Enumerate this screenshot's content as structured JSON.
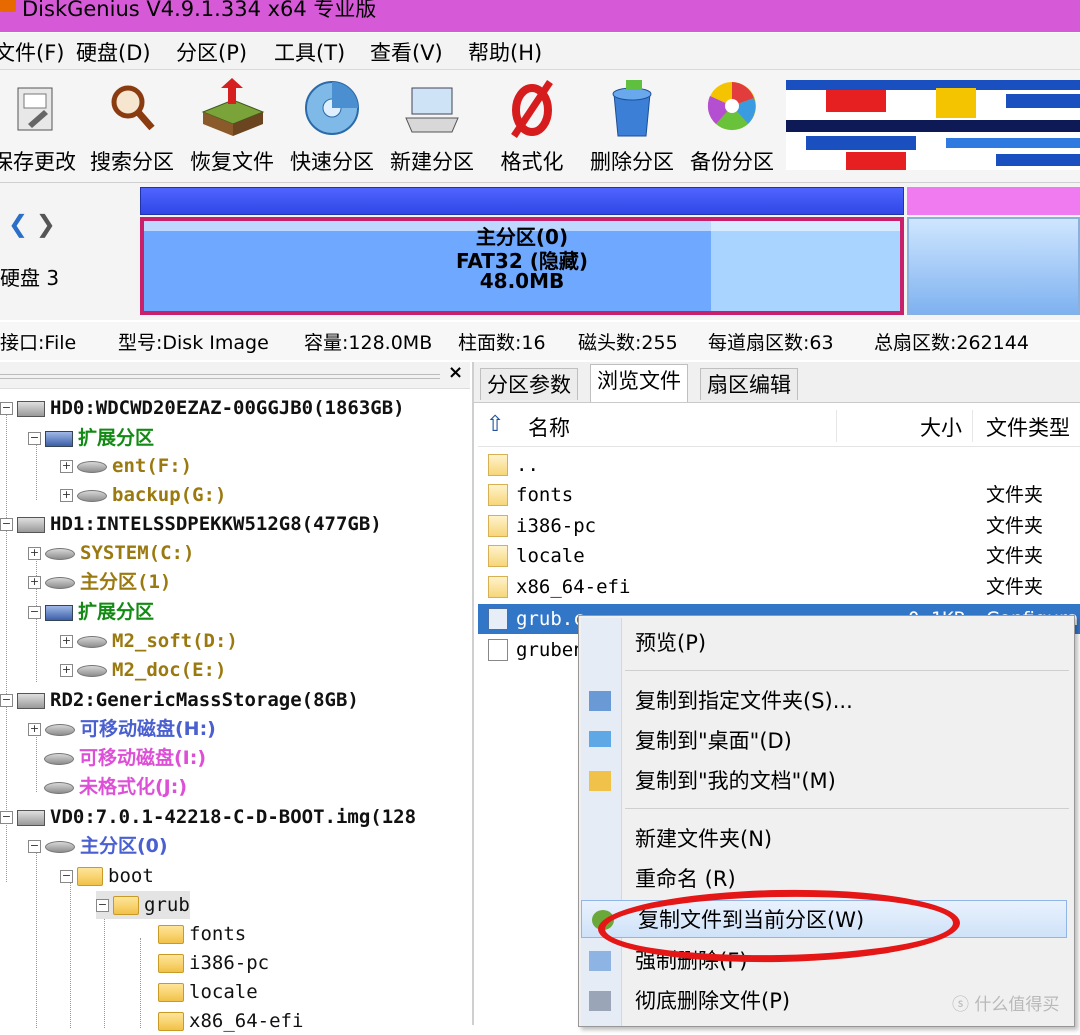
{
  "window": {
    "title": "DiskGenius V4.9.1.334 x64 专业版"
  },
  "menu": [
    "文件(F)",
    "硬盘(D)",
    "分区(P)",
    "工具(T)",
    "查看(V)",
    "帮助(H)"
  ],
  "toolbar": [
    {
      "label": "保存更改",
      "icon": "save-icon"
    },
    {
      "label": "搜索分区",
      "icon": "magnifier-icon"
    },
    {
      "label": "恢复文件",
      "icon": "recover-icon"
    },
    {
      "label": "快速分区",
      "icon": "quick-partition-icon"
    },
    {
      "label": "新建分区",
      "icon": "new-partition-icon"
    },
    {
      "label": "格式化",
      "icon": "format-icon"
    },
    {
      "label": "删除分区",
      "icon": "trash-icon"
    },
    {
      "label": "备份分区",
      "icon": "backup-icon"
    }
  ],
  "diskmap": {
    "disk_label": "硬盘 3",
    "partition": {
      "name": "主分区(0)",
      "fs": "FAT32 (隐藏)",
      "size": "48.0MB"
    }
  },
  "diskinfo": {
    "interface": "接口:File",
    "model": "型号:Disk Image",
    "capacity": "容量:128.0MB",
    "cylinders": "柱面数:16",
    "heads": "磁头数:255",
    "sectors_per_track": "每道扇区数:63",
    "total_sectors": "总扇区数:262144"
  },
  "tree": {
    "close": "×",
    "rows": [
      "HD0:WDCWD20EZAZ-00GGJB0(1863GB)",
      "扩展分区",
      "ent(F:)",
      "backup(G:)",
      "HD1:INTELSSDPEKKW512G8(477GB)",
      "SYSTEM(C:)",
      "主分区(1)",
      "扩展分区",
      "M2_soft(D:)",
      "M2_doc(E:)",
      "RD2:GenericMassStorage(8GB)",
      "可移动磁盘(H:)",
      "可移动磁盘(I:)",
      "未格式化(J:)",
      "VD0:7.0.1-42218-C-D-BOOT.img(128",
      "主分区(0)",
      "boot",
      "grub",
      "fonts",
      "i386-pc",
      "locale",
      "x86_64-efi"
    ]
  },
  "tabs": [
    "分区参数",
    "浏览文件",
    "扇区编辑"
  ],
  "filelist": {
    "headers": {
      "name": "名称",
      "size": "大小",
      "type": "文件类型"
    },
    "rows": [
      {
        "name": "..",
        "size": "",
        "type": ""
      },
      {
        "name": "fonts",
        "size": "",
        "type": "文件夹"
      },
      {
        "name": "i386-pc",
        "size": "",
        "type": "文件夹"
      },
      {
        "name": "locale",
        "size": "",
        "type": "文件夹"
      },
      {
        "name": "x86_64-efi",
        "size": "",
        "type": "文件夹"
      },
      {
        "name": "grub.c",
        "size": "0.1KB",
        "type": "Configura"
      },
      {
        "name": "gruben",
        "size": "",
        "type": ""
      }
    ]
  },
  "context_menu": {
    "items": [
      {
        "label": "预览(P)",
        "icon": ""
      },
      {
        "label": "复制到指定文件夹(S)...",
        "icon": "copy-to-folder-icon"
      },
      {
        "label": "复制到\"桌面\"(D)",
        "icon": "desktop-icon"
      },
      {
        "label": "复制到\"我的文档\"(M)",
        "icon": "documents-folder-icon"
      },
      {
        "label": "新建文件夹(N)",
        "icon": ""
      },
      {
        "label": "重命名 (R)",
        "icon": ""
      },
      {
        "label": "复制文件到当前分区(W)",
        "icon": "copy-to-partition-icon"
      },
      {
        "label": "强制删除(F)",
        "icon": "force-delete-icon"
      },
      {
        "label": "彻底删除文件(P)",
        "icon": "wipe-icon"
      }
    ]
  },
  "watermark": "什么值得买",
  "colors": {
    "titlebar": "#d65ad8",
    "selection": "#3276c8",
    "highlight_circle": "#e41616"
  }
}
